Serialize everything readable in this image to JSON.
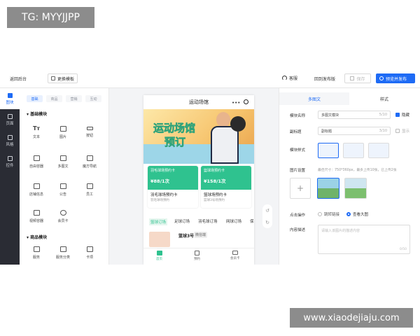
{
  "watermark": {
    "tag": "TG: MYYJJPP",
    "site": "www.xiaodejiaju.com"
  },
  "topbar": {
    "back": "返回后台",
    "change_template": "更换模板",
    "service": "客服",
    "back_to_publish": "回到发布版",
    "save": "保存",
    "preview_publish": "预览并发布"
  },
  "rail": [
    {
      "label": "图块"
    },
    {
      "label": "页面"
    },
    {
      "label": "风格"
    },
    {
      "label": "控件"
    }
  ],
  "panel": {
    "tabs": [
      "基础",
      "商品",
      "营销",
      "互动"
    ],
    "section_basic": "基础模块",
    "basic_items": [
      "文本",
      "图片",
      "按钮",
      "自由容器",
      "多图文",
      "魔方导航",
      "店铺信息",
      "公告",
      "员工",
      "视频容器",
      "会员卡"
    ],
    "section_goods": "商品模块",
    "goods_items": [
      "服务",
      "服务分类",
      "卡项"
    ]
  },
  "phone": {
    "title": "运动场馆",
    "banner_line1": "运动场馆",
    "banner_line2": "预订",
    "cards": [
      {
        "top_label": "羽毛球场预约卡",
        "price": "¥88/1次",
        "name": "羽毛球场预约卡",
        "sub": "羽毛球场预约"
      },
      {
        "top_label": "篮球场预约卡",
        "price": "¥158/1次",
        "name": "篮球场预约卡",
        "sub": "篮球3号场预约"
      }
    ],
    "tabs": [
      "篮球订场",
      "足球订场",
      "羽毛球订场",
      "网球订场",
      "保"
    ],
    "list_item_title": "篮球3号",
    "list_item_sub": "微信端",
    "nav": [
      "首页",
      "预约",
      "会员卡"
    ],
    "accent": "#2fc28f"
  },
  "settings": {
    "tabs": [
      "多图文",
      "样式"
    ],
    "module_name_label": "模块名称",
    "module_name_value": "多图文模块",
    "module_name_count": "5/10",
    "hide_label": "隐藏",
    "subtitle_label": "副标题",
    "subtitle_value": "副标题",
    "subtitle_count": "3/10",
    "subtitle_show_label": "显示",
    "style_label": "模块样式",
    "image_label": "图片设置",
    "image_hint": "最佳尺寸：750*360px，最多上传10张，已上传2张",
    "click_label": "点击操作",
    "click_opt1": "跳转链接",
    "click_opt2": "查看大图",
    "desc_label": "内容描述",
    "desc_placeholder": "请输入该图片的描述内容",
    "desc_count": "0/50"
  },
  "colors": {
    "primary": "#1e6bf5",
    "rail_bg": "#2a2c34",
    "green": "#2fc28f"
  }
}
